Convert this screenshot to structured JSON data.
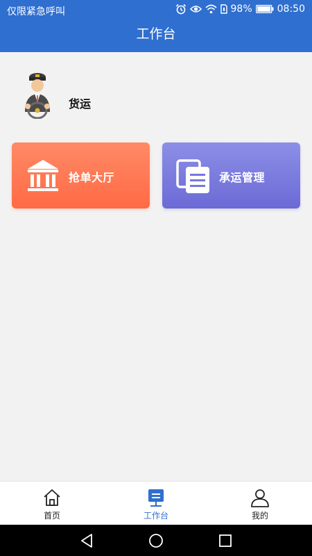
{
  "status_bar": {
    "carrier_text": "仅限紧急呼叫",
    "battery": "98%",
    "time": "08:50",
    "icons": [
      "alarm-icon",
      "eye-icon",
      "wifi-icon",
      "sim-icon",
      "battery-icon"
    ]
  },
  "header": {
    "title": "工作台"
  },
  "profile": {
    "name": "货运",
    "avatar_icon": "driver-avatar-icon"
  },
  "cards": {
    "grab_orders": {
      "label": "抢单大厅",
      "icon": "hall-building-icon",
      "color": "#ff7350"
    },
    "carrier_management": {
      "label": "承运管理",
      "icon": "documents-icon",
      "color": "#7677dc"
    }
  },
  "bottom_nav": {
    "items": [
      {
        "label": "首页",
        "icon": "home-icon",
        "active": false
      },
      {
        "label": "工作台",
        "icon": "workbench-icon",
        "active": true
      },
      {
        "label": "我的",
        "icon": "user-icon",
        "active": false
      }
    ]
  },
  "colors": {
    "brand": "#2f6fcf",
    "background": "#f2f2f2"
  },
  "system_nav": {
    "icons": [
      "back-icon",
      "home-circle-icon",
      "recents-icon"
    ]
  }
}
